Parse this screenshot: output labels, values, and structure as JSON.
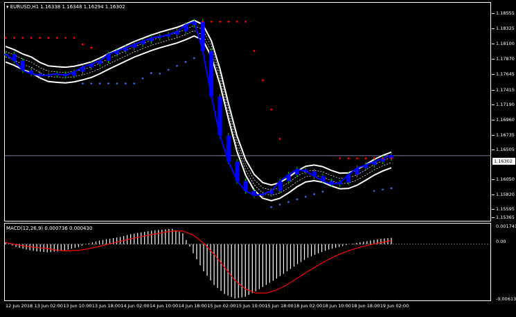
{
  "symbol_header": "EURUSD,H1  1.16338 1.16348 1.16294 1.16302",
  "macd_header": "MACD(12,26,9) 0.000736 0.000430",
  "current_price": "1.16302",
  "price_axis": [
    "1.18555",
    "1.18325",
    "1.18100",
    "1.17870",
    "1.17645",
    "1.17415",
    "1.17190",
    "1.16960",
    "1.16735",
    "1.16505",
    "1.16050",
    "1.15820",
    "1.15595",
    "1.15365"
  ],
  "macd_axis": [
    "0.001741",
    "0.00",
    "-0.006134"
  ],
  "time_axis": [
    "12 Jun 2018",
    "13 Jun 02:00",
    "13 Jun 10:00",
    "13 Jun 18:00",
    "14 Jun 02:00",
    "14 Jun 10:00",
    "14 Jun 18:00",
    "15 Jun 02:00",
    "15 Jun 10:00",
    "15 Jun 18:00",
    "18 Jun 02:00",
    "18 Jun 10:00",
    "18 Jun 18:00",
    "19 Jun 02:00"
  ],
  "colors": {
    "background": "#000000",
    "frame": "#ffffff",
    "candles": "#0000ff",
    "wicks_up": "#00c000",
    "sar_red": "#ff0000",
    "sar_blue": "#3366dd",
    "envelope": "#ffffff",
    "macd_signal": "#ff0000",
    "macd_hist": "#ffffff",
    "current_line": "#8080a0"
  },
  "chart_data": [
    {
      "type": "line",
      "title": "EURUSD,H1",
      "y_label": "",
      "ylim": [
        1.15365,
        1.18555
      ],
      "series": [
        {
          "name": "EURUSD",
          "values": [
            1.1785,
            1.1775,
            1.176,
            1.1755,
            1.1752,
            1.1753,
            1.1755,
            1.1752,
            1.1758,
            1.1765,
            1.177,
            1.1775,
            1.1785,
            1.179,
            1.1795,
            1.18,
            1.1805,
            1.181,
            1.1812,
            1.1815,
            1.182,
            1.183,
            1.1835,
            1.179,
            1.172,
            1.166,
            1.162,
            1.159,
            1.1575,
            1.1568,
            1.157,
            1.1575,
            1.159,
            1.16,
            1.1608,
            1.1605,
            1.1598,
            1.159,
            1.1585,
            1.1588,
            1.16,
            1.161,
            1.1615,
            1.162,
            1.1625,
            1.163
          ]
        }
      ]
    },
    {
      "type": "bar",
      "title": "MACD(12,26,9)",
      "ylim": [
        -0.006134,
        0.001741
      ],
      "series": [
        {
          "name": "MACD",
          "values": [
            0.0002,
            -0.0003,
            -0.0006,
            -0.0008,
            -0.0009,
            -0.0008,
            -0.0006,
            -0.0003,
            0.0001,
            0.0004,
            0.0006,
            0.0008,
            0.0011,
            0.0013,
            0.0015,
            0.0016,
            0.0017,
            0.0012,
            -0.001,
            -0.003,
            -0.0045,
            -0.0055,
            -0.006,
            -0.0058,
            -0.0052,
            -0.0045,
            -0.0038,
            -0.003,
            -0.0022,
            -0.0015,
            -0.001,
            -0.0006,
            -0.0003,
            0.0,
            0.0002,
            0.0004,
            0.0006,
            0.0007
          ]
        }
      ]
    }
  ]
}
